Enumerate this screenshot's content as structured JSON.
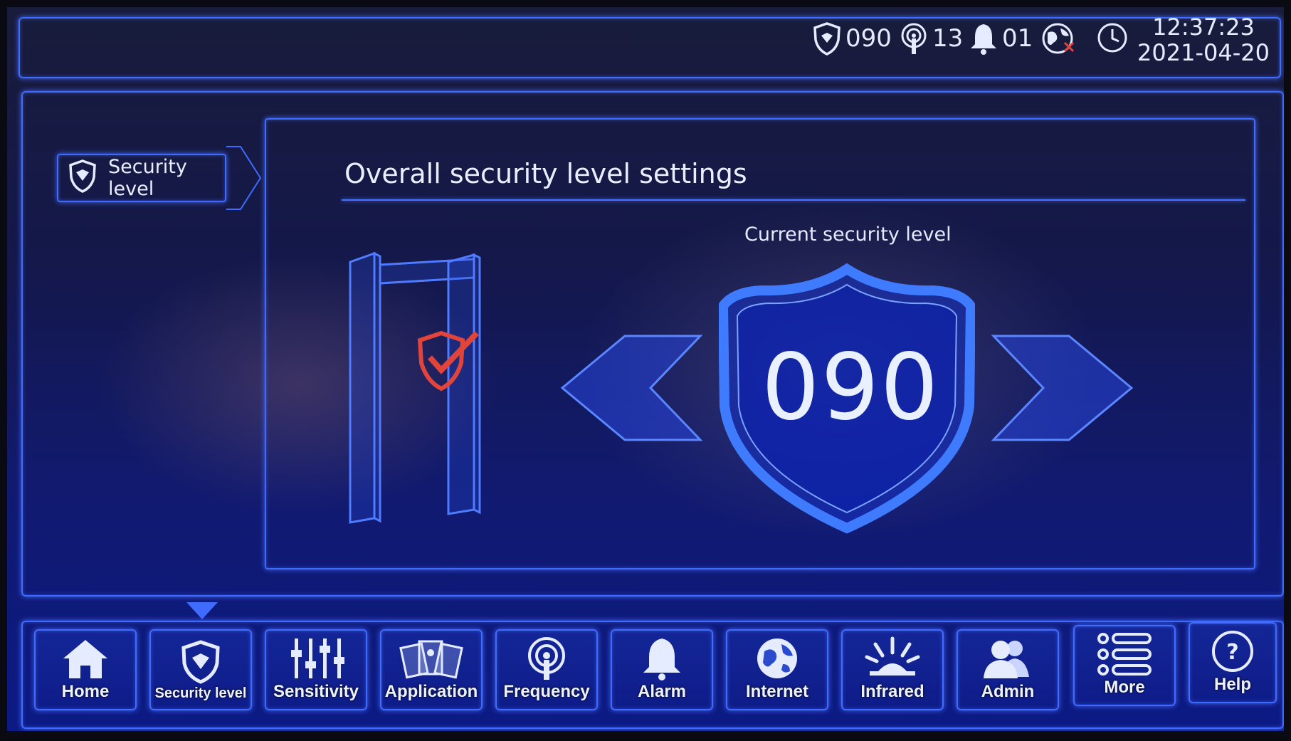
{
  "status": {
    "security_level": "090",
    "frequency": "13",
    "alarm": "01",
    "time": "12:37:23",
    "date": "2021-04-20"
  },
  "side_tab": {
    "label": "Security level"
  },
  "main": {
    "title": "Overall security level settings",
    "current_label": "Current security level",
    "current_value": "090"
  },
  "nav": {
    "home": "Home",
    "security": "Security level",
    "sensitivity": "Sensitivity",
    "application": "Application",
    "frequency": "Frequency",
    "alarm": "Alarm",
    "internet": "Internet",
    "infrared": "Infrared",
    "admin": "Admin",
    "more": "More",
    "help": "Help"
  },
  "icons": {
    "status": [
      "shield-icon",
      "frequency-icon",
      "bell-icon",
      "globe-icon",
      "clock-icon"
    ],
    "nav": [
      "home-icon",
      "shield-icon",
      "sliders-icon",
      "cards-icon",
      "frequency-icon",
      "bell-icon",
      "globe-icon",
      "infrared-icon",
      "users-icon",
      "list-icon",
      "help-icon"
    ]
  },
  "colors": {
    "accent": "#3f6bff",
    "check": "#e0443a",
    "text": "#e6ecff"
  }
}
